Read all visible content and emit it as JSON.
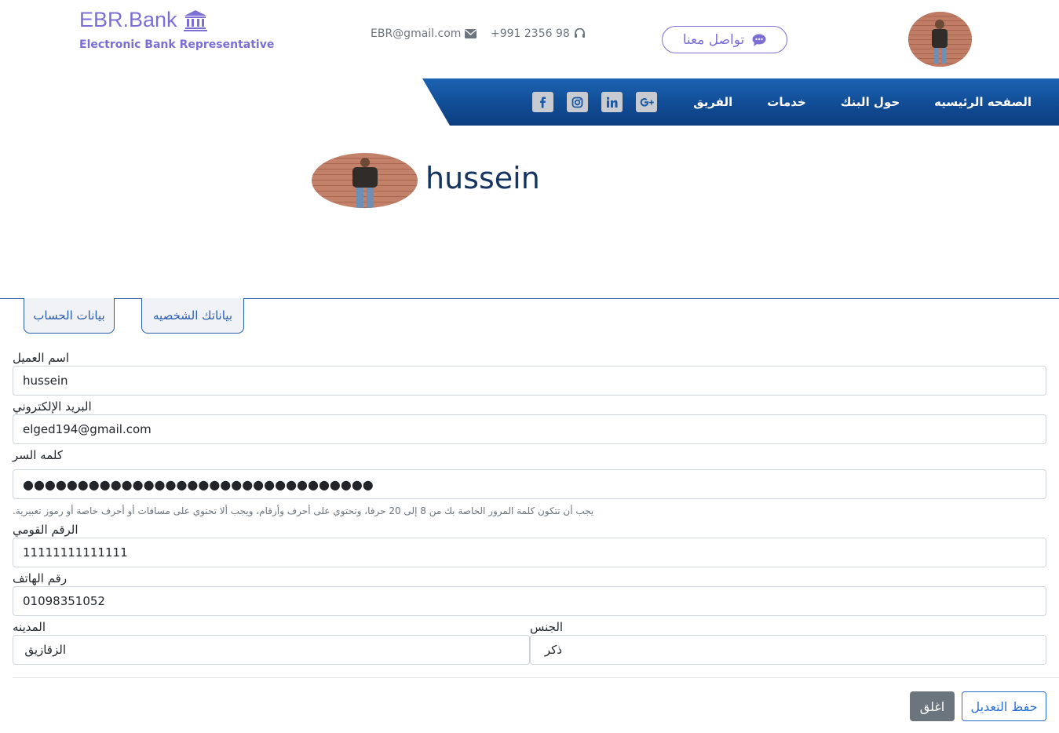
{
  "header": {
    "brand_name": "EBR.Bank",
    "brand_sub": "Electronic Bank Representative",
    "email": "EBR@gmail.com",
    "phone": "+991 2356 98",
    "contact_button": "تواصل معنا",
    "brand_color": "#7b6fd6"
  },
  "nav": {
    "items": [
      "الصفحه الرئيسيه",
      "حول البنك",
      "خدمات",
      "الفريق"
    ],
    "socials": [
      "google-plus-icon",
      "linkedin-icon",
      "instagram-icon",
      "facebook-icon"
    ],
    "bar_color": "#104a92"
  },
  "profile": {
    "name": "hussein"
  },
  "tabs": {
    "account": "بيانات الحساب",
    "personal": "بياناتك الشخصيه"
  },
  "form": {
    "name_label": "اسم العميل",
    "name_value": "hussein",
    "email_label": "البريد الإلكتروني",
    "email_value": "elged194@gmail.com",
    "password_label": "كلمه السر",
    "password_value": "●●●●●●●●●●●●●●●●●●●●●●●●●●●●●●●●",
    "password_help": "يجب أن تتكون كلمة المرور الخاصة بك من 8 إلى 20 حرفا، وتحتوي على أحرف وأرقام، ويجب ألا تحتوي على مسافات أو أحرف خاصة أو رموز تعبيرية.",
    "national_id_label": "الرقم القومي",
    "national_id_value": "11111111111111",
    "phone_label": "رقم الهاتف",
    "phone_value": "01098351052",
    "city_label": "المدينه",
    "city_value": "الزقازيق",
    "gender_label": "الجنس",
    "gender_value": "ذكر"
  },
  "footer": {
    "save": "حفظ التعديل",
    "close": "اغلق"
  }
}
